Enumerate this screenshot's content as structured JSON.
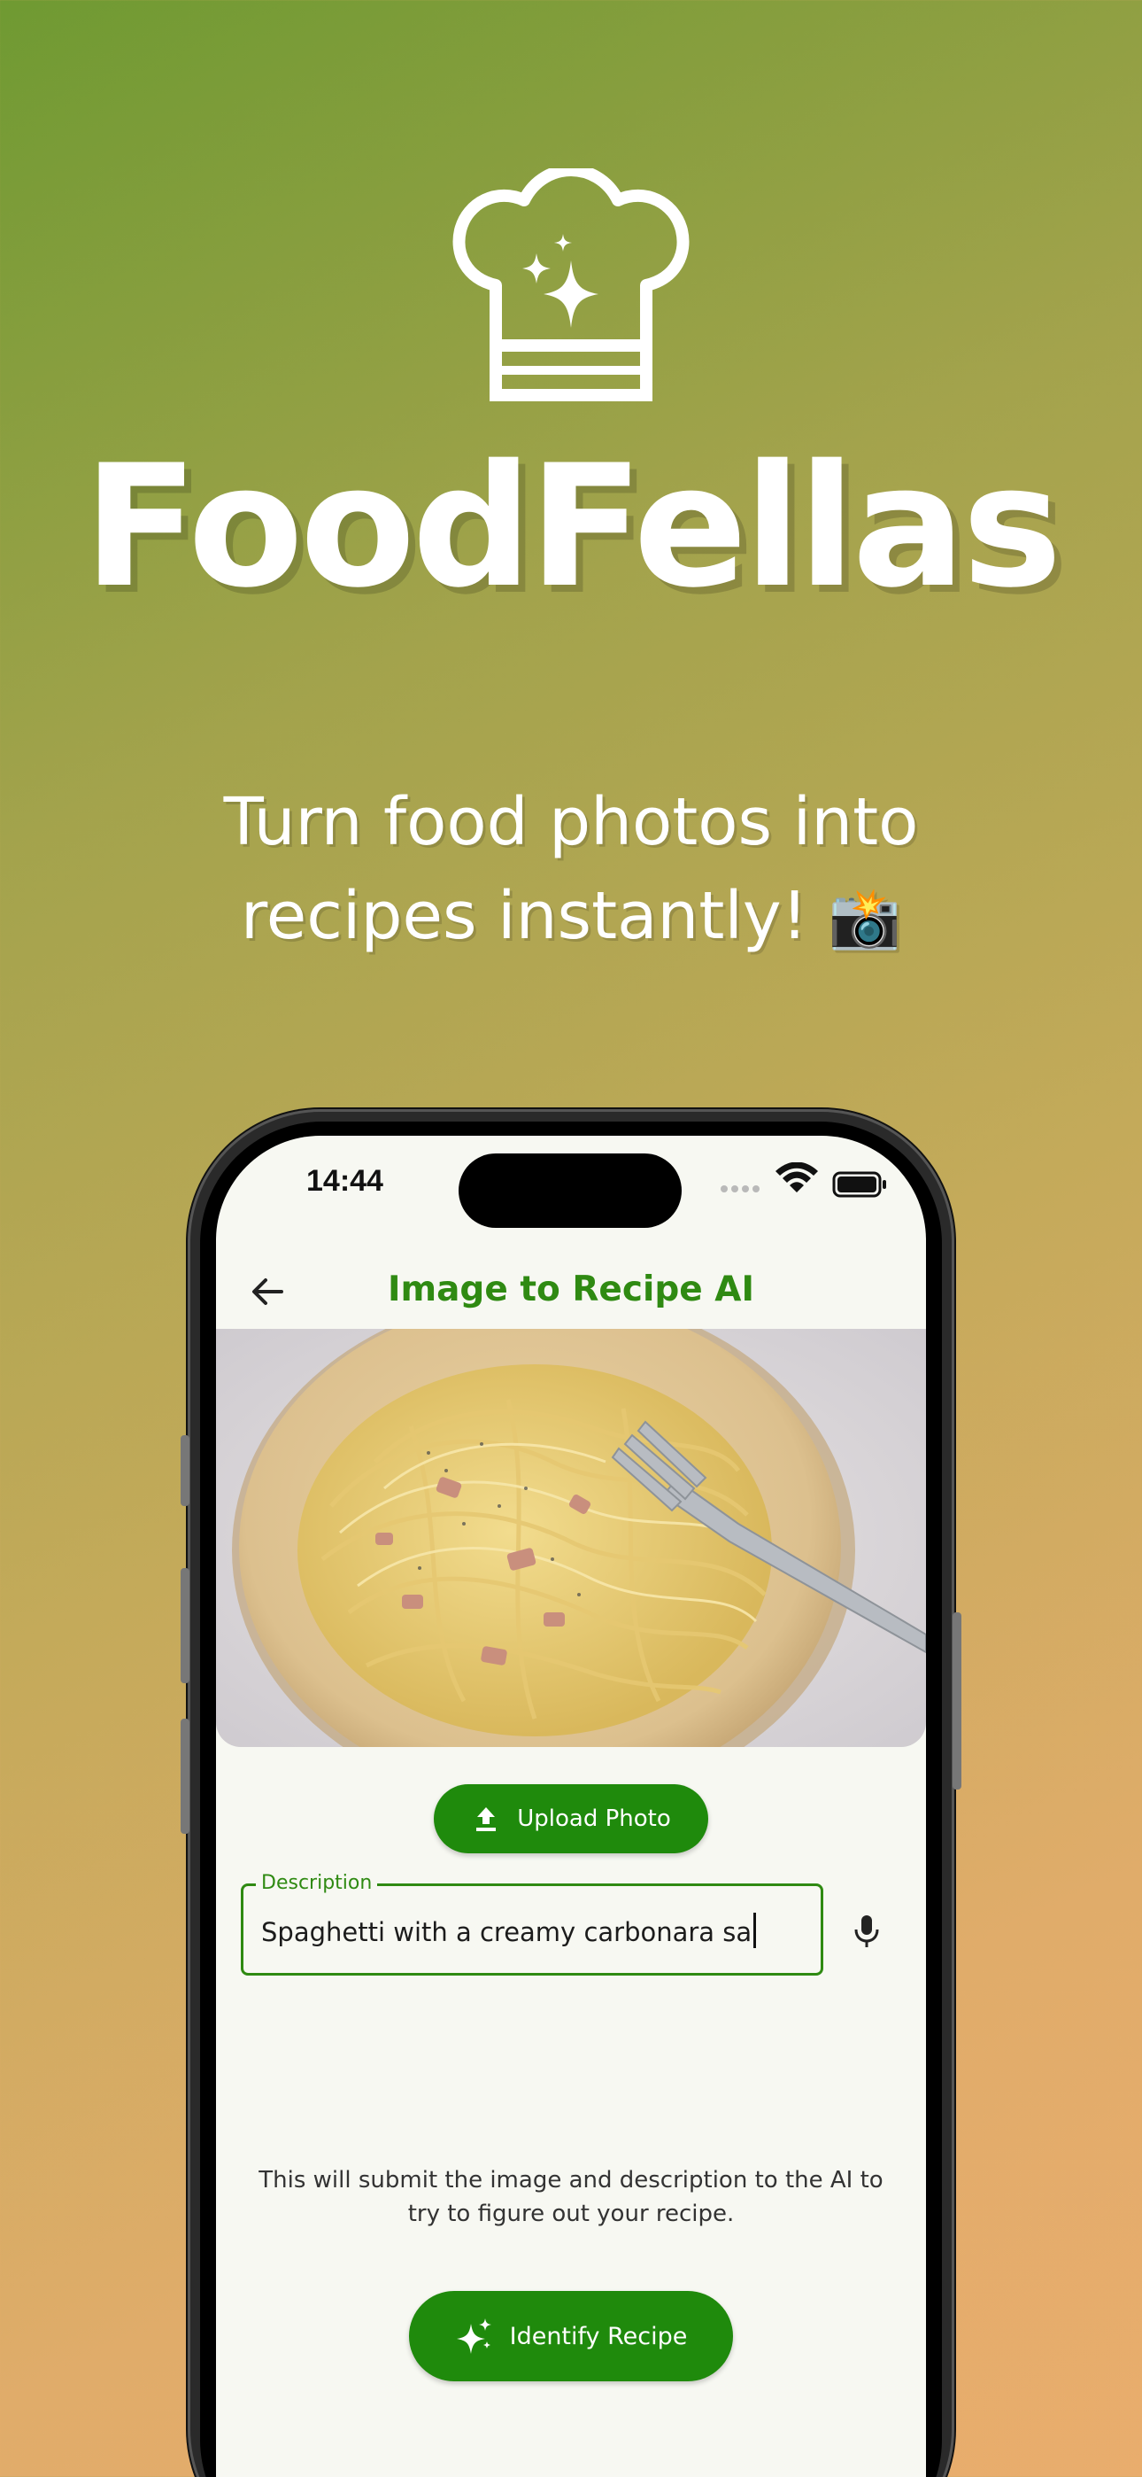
{
  "promo": {
    "app_name": "FoodFellas",
    "tagline_line1": "Turn food photos into",
    "tagline_line2": "recipes instantly!",
    "tagline_emoji": "📸",
    "hero_icon": "chef-hat-sparkles-icon"
  },
  "status_bar": {
    "time": "14:44",
    "icons": [
      "cellular-signal-icon",
      "wifi-icon",
      "battery-icon"
    ]
  },
  "app_bar": {
    "title": "Image to Recipe AI",
    "back_icon": "arrow-left-icon"
  },
  "photo": {
    "subject": "plate of spaghetti carbonara with fork"
  },
  "upload_button": {
    "label": "Upload Photo",
    "icon": "upload-icon"
  },
  "description_field": {
    "label": "Description",
    "value": "Spaghetti with a creamy carbonara sa",
    "mic_icon": "microphone-icon"
  },
  "info_text": "This will submit the image and description to the AI to try to figure out your recipe.",
  "identify_button": {
    "label": "Identify Recipe",
    "icon": "sparkles-icon"
  },
  "colors": {
    "primary_green": "#1f8a0c",
    "title_green": "#2f8a12",
    "screen_bg": "#f7f8f2",
    "gradient_start": "#6f9a32",
    "gradient_end": "#e9ad6d"
  }
}
